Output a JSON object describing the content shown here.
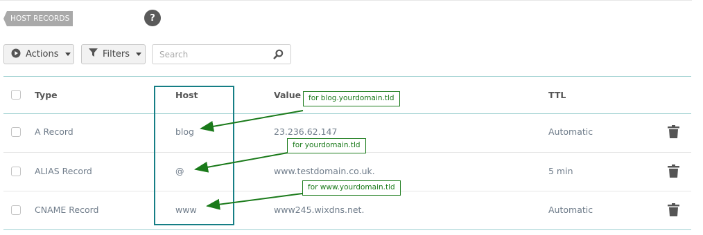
{
  "section": {
    "title": "HOST RECORDS",
    "help_label": "?"
  },
  "toolbar": {
    "actions_label": "Actions",
    "filters_label": "Filters",
    "search_placeholder": "Search"
  },
  "table": {
    "headers": {
      "type": "Type",
      "host": "Host",
      "value": "Value",
      "ttl": "TTL"
    },
    "rows": [
      {
        "type": "A Record",
        "host": "blog",
        "value": "23.236.62.147",
        "ttl": "Automatic"
      },
      {
        "type": "ALIAS Record",
        "host": "@",
        "value": "www.testdomain.co.uk.",
        "ttl": "5 min"
      },
      {
        "type": "CNAME Record",
        "host": "www",
        "value": "www245.wixdns.net.",
        "ttl": "Automatic"
      }
    ]
  },
  "annotations": {
    "labels": [
      "for blog.yourdomain.tld",
      "for yourdomain.tld",
      "for www.yourdomain.tld"
    ],
    "box_color": "#157e85",
    "arrow_color": "#1a7a1a"
  },
  "colors": {
    "tag_bg": "#a9a9a9",
    "divider_teal": "#9ccfd0",
    "value_text": "#6f7c8a"
  },
  "icons": {
    "actions": "play-circle-icon",
    "filters": "funnel-icon",
    "search": "magnifier-icon",
    "delete": "trash-icon",
    "help": "question-circle-icon"
  }
}
